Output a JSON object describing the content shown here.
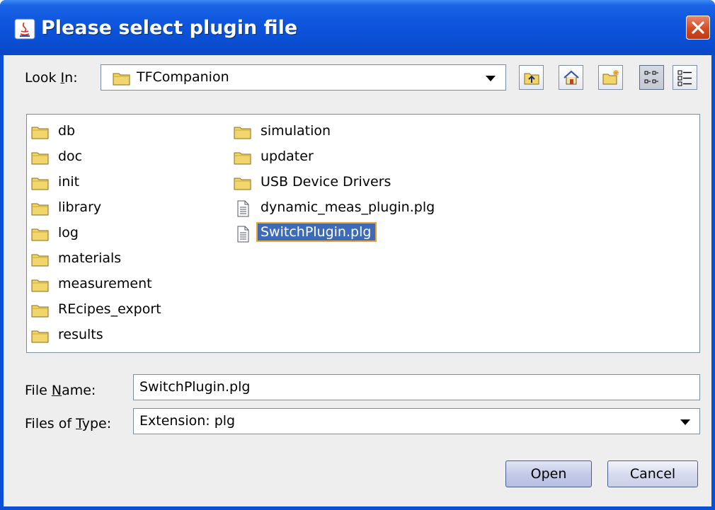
{
  "window": {
    "title": "Please select plugin file"
  },
  "look_in": {
    "label_before": "Look ",
    "label_mnemonic": "I",
    "label_after": "n:",
    "value": "TFCompanion"
  },
  "toolbar": {
    "icons": [
      "up-folder-icon",
      "home-icon",
      "new-folder-icon",
      "list-view-icon",
      "details-view-icon"
    ]
  },
  "files": {
    "col1": [
      {
        "name": "db",
        "type": "folder"
      },
      {
        "name": "doc",
        "type": "folder"
      },
      {
        "name": "init",
        "type": "folder"
      },
      {
        "name": "library",
        "type": "folder"
      },
      {
        "name": "log",
        "type": "folder"
      },
      {
        "name": "materials",
        "type": "folder"
      },
      {
        "name": "measurement",
        "type": "folder"
      },
      {
        "name": "REcipes_export",
        "type": "folder"
      },
      {
        "name": "results",
        "type": "folder"
      }
    ],
    "col2": [
      {
        "name": "simulation",
        "type": "folder"
      },
      {
        "name": "updater",
        "type": "folder"
      },
      {
        "name": "USB Device Drivers",
        "type": "folder"
      },
      {
        "name": "dynamic_meas_plugin.plg",
        "type": "file"
      },
      {
        "name": "SwitchPlugin.plg",
        "type": "file",
        "selected": true
      }
    ]
  },
  "file_name": {
    "label_before": "File ",
    "label_mnemonic": "N",
    "label_after": "ame:",
    "value": "SwitchPlugin.plg"
  },
  "files_of_type": {
    "label_before": "Files of ",
    "label_mnemonic": "T",
    "label_after": "ype:",
    "value": "Extension: plg"
  },
  "buttons": {
    "open": "Open",
    "cancel": "Cancel"
  },
  "colors": {
    "title_bar": "#0a4fd8",
    "selection": "#3d6bb5",
    "selection_border": "#f0a13a",
    "folder": "#f2d66b"
  }
}
